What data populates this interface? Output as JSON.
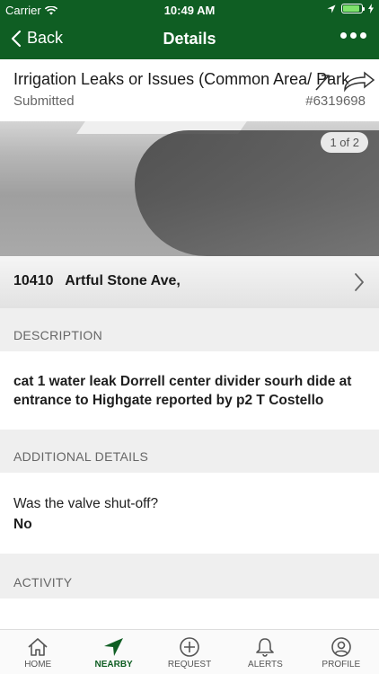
{
  "status_bar": {
    "carrier": "Carrier",
    "time": "10:49 AM",
    "battery_level": 0.9
  },
  "nav": {
    "back_label": "Back",
    "title": "Details",
    "more_icon": "more-dots-icon"
  },
  "request": {
    "title": "Irrigation Leaks or Issues (Common Area/ Park",
    "status": "Submitted",
    "id": "#6319698"
  },
  "photo": {
    "counter": "1 of 2"
  },
  "address": {
    "text": "10410   Artful Stone Ave,"
  },
  "sections": {
    "description_label": "DESCRIPTION",
    "additional_label": "ADDITIONAL DETAILS",
    "activity_label": "ACTIVITY"
  },
  "description": "cat 1 water leak Dorrell center divider sourh dide at entrance to Highgate reported by p2 T Costello",
  "additional": {
    "question": "Was the valve shut-off?",
    "answer": "No"
  },
  "tabs": [
    {
      "label": "HOME",
      "icon": "home-icon",
      "active": false
    },
    {
      "label": "NEARBY",
      "icon": "location-arrow-icon",
      "active": true
    },
    {
      "label": "REQUEST",
      "icon": "plus-circle-icon",
      "active": false
    },
    {
      "label": "ALERTS",
      "icon": "bell-icon",
      "active": false
    },
    {
      "label": "PROFILE",
      "icon": "profile-icon",
      "active": false
    }
  ],
  "colors": {
    "brand_green": "#0f5e23",
    "background": "#efefef"
  }
}
